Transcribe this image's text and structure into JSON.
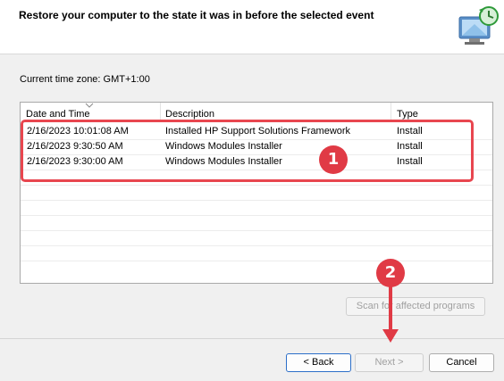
{
  "header": {
    "title": "Restore your computer to the state it was in before the selected event",
    "icon": "system-restore-icon"
  },
  "timezone_label": "Current time zone: GMT+1:00",
  "table": {
    "columns": [
      "Date and Time",
      "Description",
      "Type"
    ],
    "sorted_column": "Date and Time",
    "rows": [
      {
        "date": "2/16/2023 10:01:08 AM",
        "description": "Installed HP Support Solutions Framework",
        "type": "Install"
      },
      {
        "date": "2/16/2023 9:30:50 AM",
        "description": "Windows Modules Installer",
        "type": "Install"
      },
      {
        "date": "2/16/2023 9:30:00 AM",
        "description": "Windows Modules Installer",
        "type": "Install"
      }
    ]
  },
  "buttons": {
    "scan": "Scan for affected programs",
    "back": "< Back",
    "next": "Next >",
    "cancel": "Cancel"
  },
  "annotations": {
    "badge1": "1",
    "badge2": "2",
    "color": "#e03a45"
  }
}
